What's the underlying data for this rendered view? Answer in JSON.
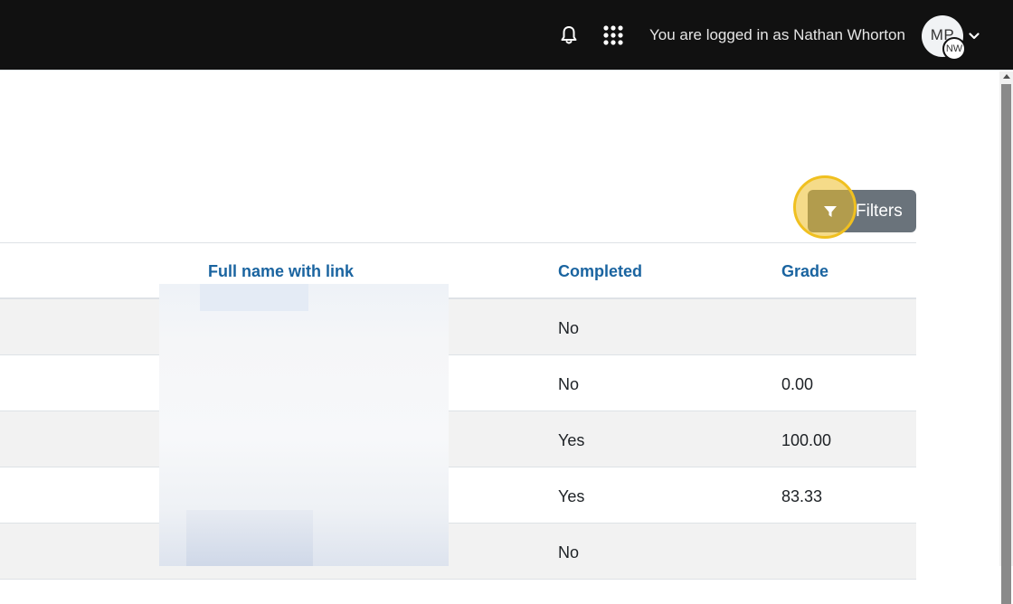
{
  "navbar": {
    "logged_in_text": "You are logged in as Nathan Whorton",
    "avatar_initials": "MP",
    "avatar_sub_initials": "NW",
    "icons": [
      "bell-icon",
      "apps-grid-icon",
      "chevron-down-icon"
    ]
  },
  "filters": {
    "label": "Filters",
    "icon": "filter-icon",
    "highlight_color": "#f0c020"
  },
  "table": {
    "columns": [
      "Full name with link",
      "Completed",
      "Grade"
    ],
    "rows": [
      {
        "completed": "No",
        "grade": ""
      },
      {
        "completed": "No",
        "grade": "0.00"
      },
      {
        "completed": "Yes",
        "grade": "100.00"
      },
      {
        "completed": "Yes",
        "grade": "83.33"
      },
      {
        "completed": "No",
        "grade": ""
      }
    ]
  },
  "colors": {
    "navbar_bg": "#111111",
    "header_link": "#1a64a0",
    "filters_button": "#6a737b",
    "row_stripe": "#f2f2f2"
  }
}
